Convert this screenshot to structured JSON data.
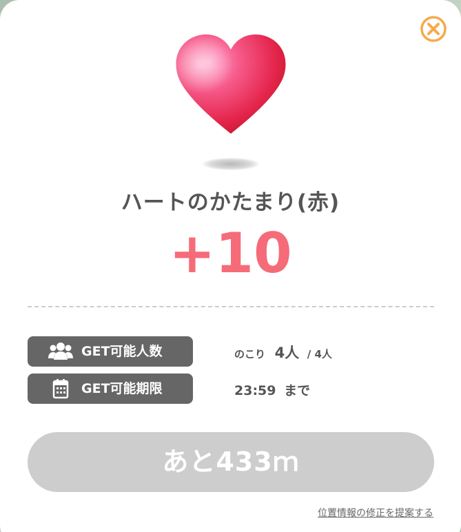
{
  "item": {
    "name": "ハートのかたまり(赤)",
    "amount": "+10"
  },
  "info": {
    "capacity": {
      "label": "GET可能人数",
      "icon": "people-icon",
      "prefix": "のこり",
      "remaining": "4人",
      "total": "/ 4人"
    },
    "deadline": {
      "label": "GET可能期限",
      "icon": "calendar-icon",
      "time": "23:59",
      "suffix": "まで"
    }
  },
  "distance_button": {
    "label": "あと433ｍ"
  },
  "report_link": {
    "label": "位置情報の修正を提案する"
  },
  "colors": {
    "accent_close": "#f6a94b",
    "amount": "#f56b78",
    "label_bg": "#666666",
    "disabled_button": "#cdcdcd"
  }
}
